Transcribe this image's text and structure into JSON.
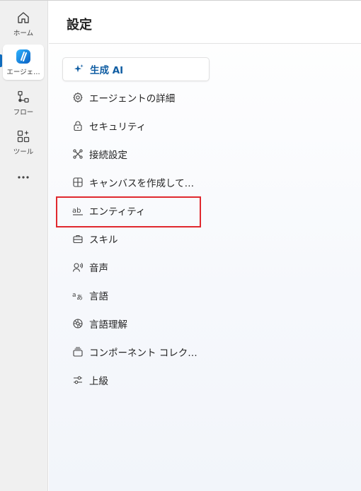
{
  "rail": {
    "items": [
      {
        "label": "ホーム",
        "icon": "home-icon"
      },
      {
        "label": "エージェ…",
        "icon": "copilot-studio-logo-icon",
        "active": true
      },
      {
        "label": "フロー",
        "icon": "flow-icon"
      },
      {
        "label": "ツール",
        "icon": "tools-icon"
      },
      {
        "label": "",
        "icon": "more-icon"
      }
    ]
  },
  "header": {
    "title": "設定"
  },
  "nav": {
    "items": [
      {
        "label": "生成 AI",
        "icon": "sparkle-icon",
        "selected": true
      },
      {
        "label": "エージェントの詳細",
        "icon": "gear-icon"
      },
      {
        "label": "セキュリティ",
        "icon": "lock-icon"
      },
      {
        "label": "接続設定",
        "icon": "connection-icon"
      },
      {
        "label": "キャンバスを作成して…",
        "icon": "canvas-icon"
      },
      {
        "label": "エンティティ",
        "icon": "entity-icon",
        "highlighted": true
      },
      {
        "label": "スキル",
        "icon": "skills-icon"
      },
      {
        "label": "音声",
        "icon": "voice-icon"
      },
      {
        "label": "言語",
        "icon": "language-icon"
      },
      {
        "label": "言語理解",
        "icon": "language-understanding-icon"
      },
      {
        "label": "コンポーネント コレク…",
        "icon": "component-collection-icon"
      },
      {
        "label": "上級",
        "icon": "advanced-icon"
      }
    ]
  },
  "colors": {
    "accent": "#115ea3",
    "highlight": "#e0282e",
    "rail_bg": "#f0f0f0"
  }
}
